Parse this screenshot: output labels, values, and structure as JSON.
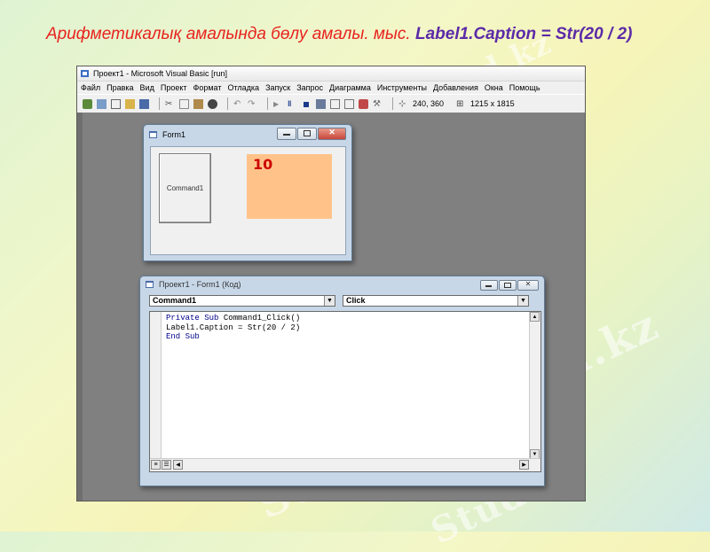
{
  "slide": {
    "heading_kz": "Арифметикалық амалында бөлу амалы. мыс.",
    "heading_code": "Label1.Caption = Str(20 / 2)",
    "watermark": "Stud.kz - Stud.kz"
  },
  "ide": {
    "title": "Проект1 - Microsoft Visual Basic [run]",
    "menu": [
      "Файл",
      "Правка",
      "Вид",
      "Проект",
      "Формат",
      "Отладка",
      "Запуск",
      "Запрос",
      "Диаграмма",
      "Инструменты",
      "Добавления",
      "Окна",
      "Помощь"
    ],
    "toolbar": {
      "position": "240, 360",
      "size": "1215 x 1815"
    }
  },
  "form1": {
    "title": "Form1",
    "command_button": "Command1",
    "label_caption": "10"
  },
  "code_window": {
    "title": "Проект1 - Form1 (Код)",
    "object_combo": "Command1",
    "procedure_combo": "Click",
    "lines": {
      "l1_kw1": "Private",
      "l1_kw2": "Sub",
      "l1_rest": "Command1_Click()",
      "l2": "Label1.Caption = Str(20 / 2)",
      "l3_kw1": "End",
      "l3_kw2": "Sub"
    }
  },
  "colors": {
    "heading_red": "#e8231e",
    "heading_purple": "#5b2aa8",
    "label_bg": "#ffc38a",
    "label_text": "#cc0000",
    "workspace": "#808080"
  }
}
